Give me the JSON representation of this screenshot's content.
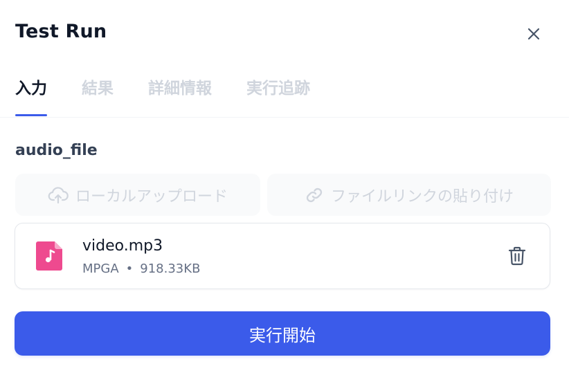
{
  "header": {
    "title": "Test Run",
    "close_icon": "close-icon"
  },
  "tabs": [
    {
      "label": "入力",
      "active": true
    },
    {
      "label": "結果",
      "active": false
    },
    {
      "label": "詳細情報",
      "active": false
    },
    {
      "label": "実行追跡",
      "active": false
    }
  ],
  "form": {
    "field_label": "audio_file",
    "upload_local": {
      "label": "ローカルアップロード",
      "icon": "cloud-upload-icon"
    },
    "upload_link": {
      "label": "ファイルリンクの貼り付け",
      "icon": "link-icon"
    },
    "file": {
      "name": "video.mp3",
      "type": "MPGA",
      "separator": "•",
      "size": "918.33KB",
      "icon": "audio-file-icon",
      "delete_icon": "trash-icon"
    }
  },
  "actions": {
    "run_label": "実行開始"
  },
  "colors": {
    "accent": "#3b5bea",
    "file_icon": "#ee4a8f",
    "muted": "#d0d5dd"
  }
}
